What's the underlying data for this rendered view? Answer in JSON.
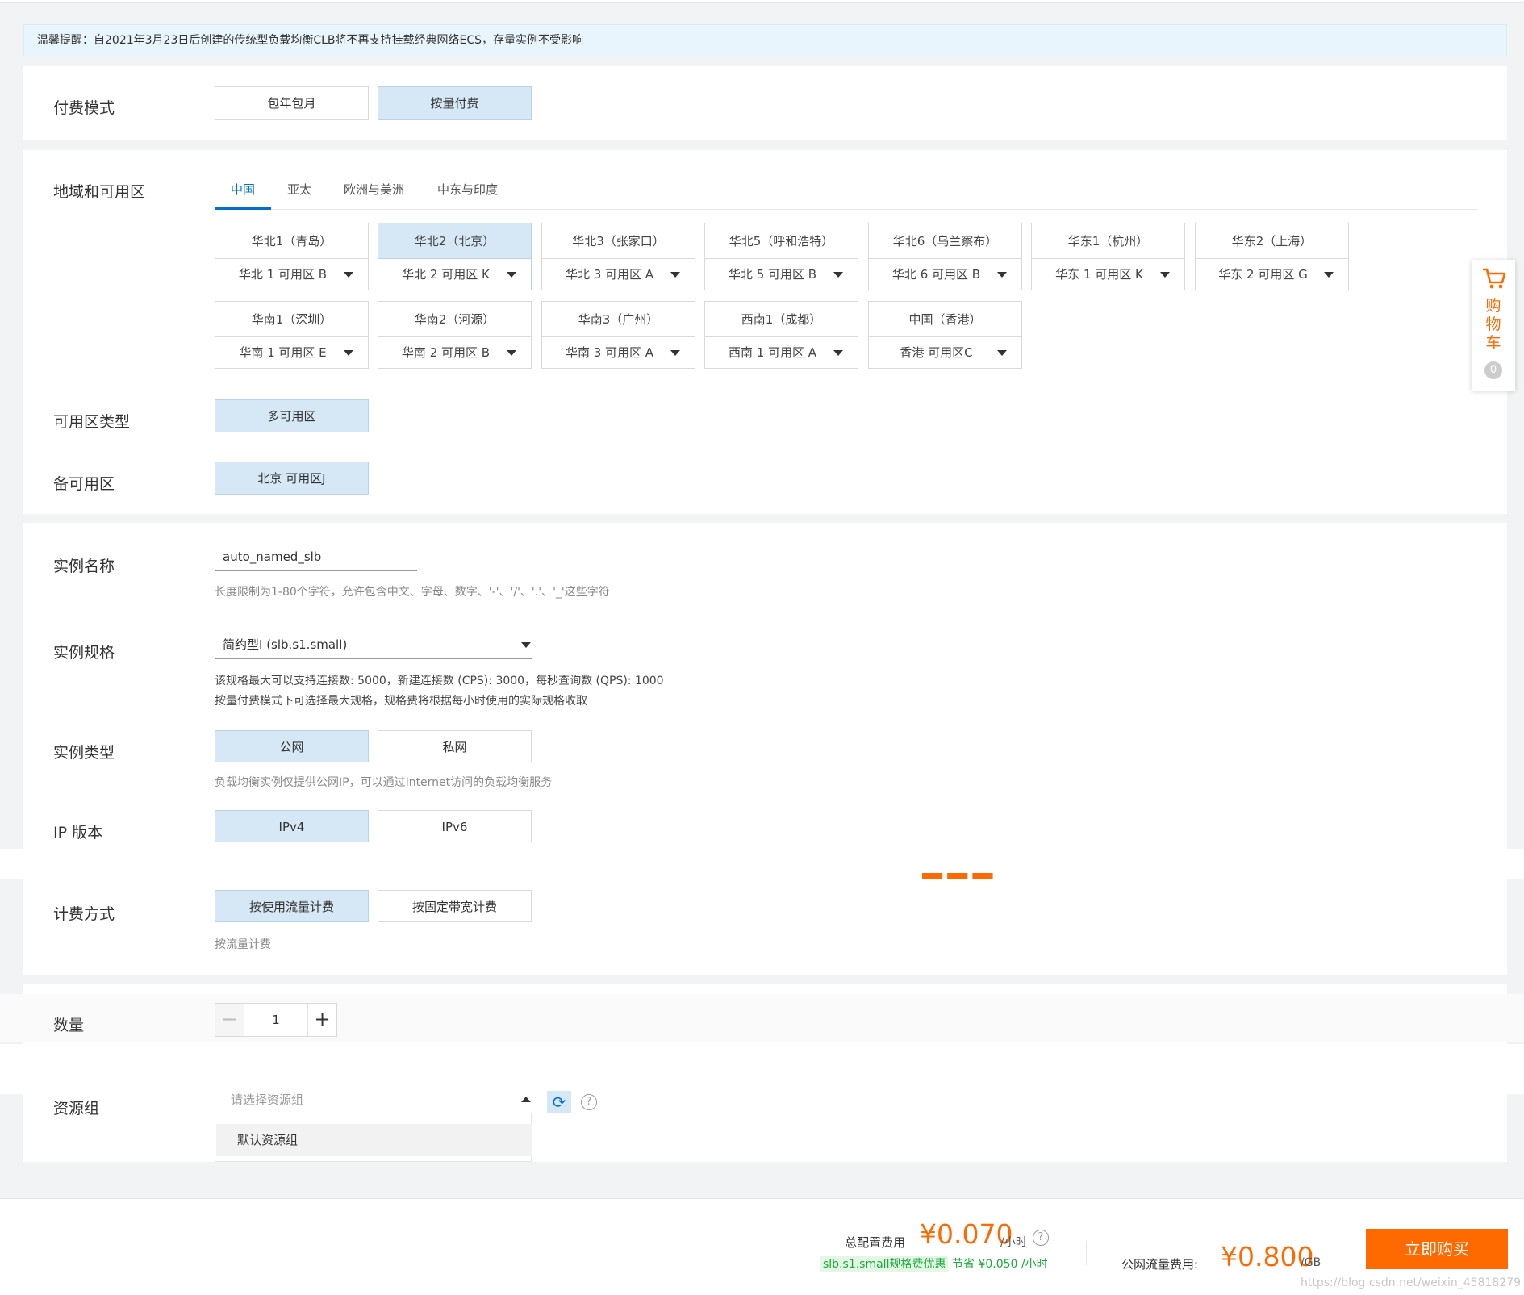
{
  "notice": "温馨提醒：自2021年3月23日后创建的传统型负载均衡CLB将不再支持挂载经典网络ECS，存量实例不受影响",
  "billing_mode": {
    "label": "付费模式",
    "options": [
      "包年包月",
      "按量付费"
    ],
    "selected": "按量付费"
  },
  "region": {
    "label": "地域和可用区",
    "tabs": [
      "中国",
      "亚太",
      "欧洲与美洲",
      "中东与印度"
    ],
    "active_tab": "中国",
    "regions": [
      {
        "name": "华北1（青岛）",
        "zone": "华北 1 可用区 B"
      },
      {
        "name": "华北2（北京）",
        "zone": "华北 2 可用区 K"
      },
      {
        "name": "华北3（张家口）",
        "zone": "华北 3 可用区 A"
      },
      {
        "name": "华北5（呼和浩特）",
        "zone": "华北 5 可用区 B"
      },
      {
        "name": "华北6（乌兰察布）",
        "zone": "华北 6 可用区 B"
      },
      {
        "name": "华东1（杭州）",
        "zone": "华东 1 可用区 K"
      },
      {
        "name": "华东2（上海）",
        "zone": "华东 2 可用区 G"
      },
      {
        "name": "华南1（深圳）",
        "zone": "华南 1 可用区 E"
      },
      {
        "name": "华南2（河源）",
        "zone": "华南 2 可用区 B"
      },
      {
        "name": "华南3（广州）",
        "zone": "华南 3 可用区 A"
      },
      {
        "name": "西南1（成都）",
        "zone": "西南 1 可用区 A"
      },
      {
        "name": "中国（香港）",
        "zone": "香港 可用区C"
      }
    ],
    "selected": "华北2（北京）"
  },
  "zone_type": {
    "label": "可用区类型",
    "value": "多可用区"
  },
  "backup_zone": {
    "label": "备可用区",
    "value": "北京 可用区J"
  },
  "instance_name": {
    "label": "实例名称",
    "value": "auto_named_slb",
    "hint": "长度限制为1-80个字符，允许包含中文、字母、数字、'-'、'/'、'.'、'_'这些字符"
  },
  "instance_spec": {
    "label": "实例规格",
    "value": "简约型I (slb.s1.small)",
    "desc1": "该规格最大可以支持连接数: 5000，新建连接数 (CPS): 3000，每秒查询数 (QPS): 1000",
    "desc2": "按量付费模式下可选择最大规格，规格费将根据每小时使用的实际规格收取"
  },
  "instance_type": {
    "label": "实例类型",
    "options": [
      "公网",
      "私网"
    ],
    "selected": "公网",
    "hint": "负载均衡实例仅提供公网IP，可以通过Internet访问的负载均衡服务"
  },
  "ip_version": {
    "label": "IP 版本",
    "options": [
      "IPv4",
      "IPv6"
    ],
    "selected": "IPv4"
  },
  "charge_type": {
    "label": "计费方式",
    "options": [
      "按使用流量计费",
      "按固定带宽计费"
    ],
    "selected": "按使用流量计费",
    "hint": "按流量计费"
  },
  "quantity": {
    "label": "数量",
    "value": "1",
    "minus": "−",
    "plus": "+"
  },
  "resource_group": {
    "label": "资源组",
    "placeholder": "请选择资源组",
    "options": [
      "默认资源组"
    ]
  },
  "cart": {
    "text": "购物车",
    "count": "0"
  },
  "footer": {
    "total_label": "总配置费用",
    "total_price": "¥0.070",
    "total_unit": "/小时",
    "discount_tag": "slb.s1.small规格费优惠",
    "save_text": "节省 ¥0.050 /小时",
    "traffic_label": "公网流量费用:",
    "traffic_price": "¥0.800",
    "traffic_unit": "/GB",
    "buy_label": "立即购买",
    "watermark": "https://blog.csdn.net/weixin_45818279"
  },
  "colors": {
    "accent": "#0070cc",
    "selected_bg": "#d6e8f5",
    "price": "#ff6a00",
    "discount": "#1aaa3b"
  },
  "icons": {
    "cart": "cart-icon",
    "refresh": "refresh-icon",
    "help": "question-icon",
    "caret": "caret-down-icon"
  }
}
